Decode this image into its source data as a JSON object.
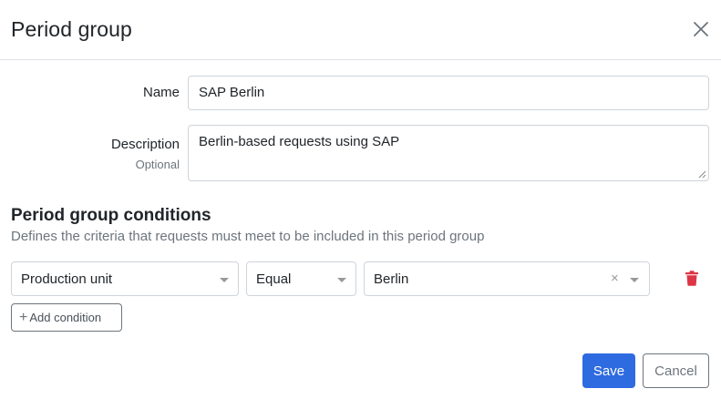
{
  "dialog": {
    "title": "Period group",
    "close_icon": "close-icon"
  },
  "form": {
    "name": {
      "label": "Name",
      "value": "SAP Berlin"
    },
    "description": {
      "label": "Description",
      "sublabel": "Optional",
      "value": "Berlin-based requests using SAP"
    }
  },
  "conditions": {
    "title": "Period group conditions",
    "description": "Defines the criteria that requests must meet to be included in this period group",
    "rows": [
      {
        "field": "Production unit",
        "operator": "Equal",
        "value": "Berlin"
      }
    ],
    "add_label": "Add condition"
  },
  "footer": {
    "save_label": "Save",
    "cancel_label": "Cancel"
  },
  "colors": {
    "primary": "#2f6be0",
    "danger": "#dc3545",
    "muted": "#6c757d"
  }
}
